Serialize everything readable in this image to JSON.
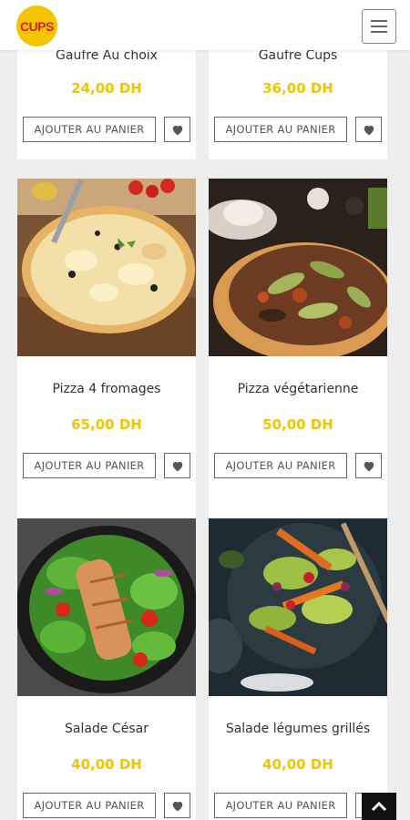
{
  "header": {
    "logo_text": "CUPS",
    "brand_color": "#f5c400",
    "menu_icon": "hamburger-icon"
  },
  "products": [
    {
      "name": "Gaufre Au choix",
      "price": "24,00 DH",
      "add_label": "AJOUTER AU PANIER"
    },
    {
      "name": "Gaufre Cups",
      "price": "36,00 DH",
      "add_label": "AJOUTER AU PANIER"
    },
    {
      "name": "Pizza 4 fromages",
      "price": "65,00 DH",
      "add_label": "AJOUTER AU PANIER",
      "image": "pizza-4-fromages"
    },
    {
      "name": "Pizza végétarienne",
      "price": "50,00 DH",
      "add_label": "AJOUTER AU PANIER",
      "image": "pizza-vegetarienne"
    },
    {
      "name": "Salade César",
      "price": "40,00 DH",
      "add_label": "AJOUTER AU PANIER",
      "image": "salade-cesar"
    },
    {
      "name": "Salade légumes grillés",
      "price": "40,00 DH",
      "add_label": "AJOUTER AU PANIER",
      "image": "salade-legumes-grilles"
    }
  ],
  "colors": {
    "price": "#f2c400",
    "accent_red": "#d42020"
  },
  "scroll_top_icon": "chevron-up-icon"
}
